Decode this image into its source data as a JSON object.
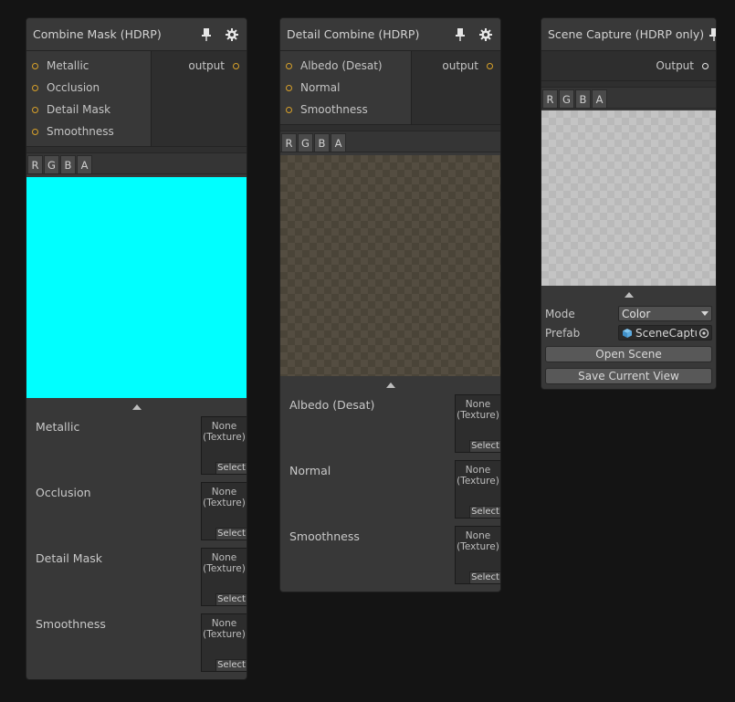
{
  "nodes": {
    "combine": {
      "title": "Combine Mask (HDRP)",
      "inputs": [
        "Metallic",
        "Occlusion",
        "Detail Mask",
        "Smoothness"
      ],
      "output": "output",
      "channels": [
        "R",
        "G",
        "B",
        "A"
      ],
      "preview_color": "#00ffff",
      "properties": [
        "Metallic",
        "Occlusion",
        "Detail Mask",
        "Smoothness"
      ],
      "texture_none": "None",
      "texture_type": "(Texture)",
      "texture_select": "Select"
    },
    "detail": {
      "title": "Detail Combine (HDRP)",
      "inputs": [
        "Albedo (Desat)",
        "Normal",
        "Smoothness"
      ],
      "output": "output",
      "channels": [
        "R",
        "G",
        "B",
        "A"
      ],
      "properties": [
        "Albedo (Desat)",
        "Normal",
        "Smoothness"
      ],
      "texture_none": "None",
      "texture_type": "(Texture)",
      "texture_select": "Select"
    },
    "scene": {
      "title": "Scene Capture (HDRP only)",
      "output": "Output",
      "channels": [
        "R",
        "G",
        "B",
        "A"
      ],
      "mode_label": "Mode",
      "mode_value": "Color",
      "prefab_label": "Prefab",
      "prefab_value": "SceneCapture",
      "open_scene": "Open Scene",
      "save_view": "Save Current View"
    }
  },
  "colors": {
    "port_input": "#d8a12a",
    "port_output_scene": "#e8e8e8",
    "background": "#141414",
    "node": "#383838"
  },
  "icons": {
    "pin": "pin-icon",
    "settings": "gear-icon",
    "collapse": "triangle-up-icon",
    "dropdown": "chevron-down-icon",
    "prefab": "prefab-cube-icon",
    "object_picker": "object-picker-icon"
  }
}
